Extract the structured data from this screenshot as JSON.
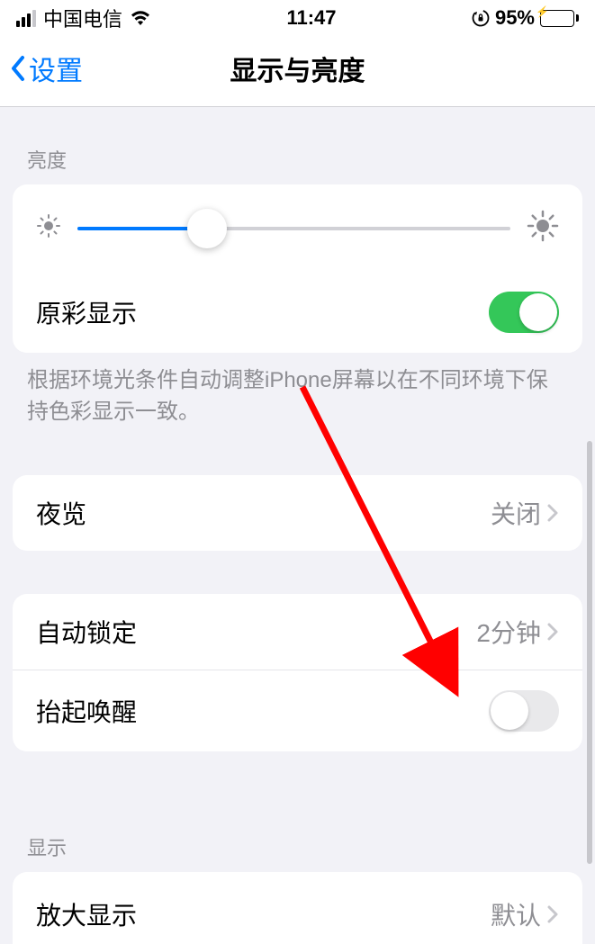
{
  "status": {
    "carrier": "中国电信",
    "time": "11:47",
    "battery_pct": "95%"
  },
  "nav": {
    "back_label": "设置",
    "title": "显示与亮度"
  },
  "brightness": {
    "header": "亮度",
    "slider_pct": 30,
    "true_tone_label": "原彩显示",
    "true_tone_on": true,
    "footer": "根据环境光条件自动调整iPhone屏幕以在不同环境下保持色彩显示一致。"
  },
  "night_shift": {
    "label": "夜览",
    "value": "关闭"
  },
  "auto_lock": {
    "label": "自动锁定",
    "value": "2分钟"
  },
  "raise_to_wake": {
    "label": "抬起唤醒",
    "on": false
  },
  "display": {
    "header": "显示",
    "zoom_label": "放大显示",
    "zoom_value": "默认"
  }
}
